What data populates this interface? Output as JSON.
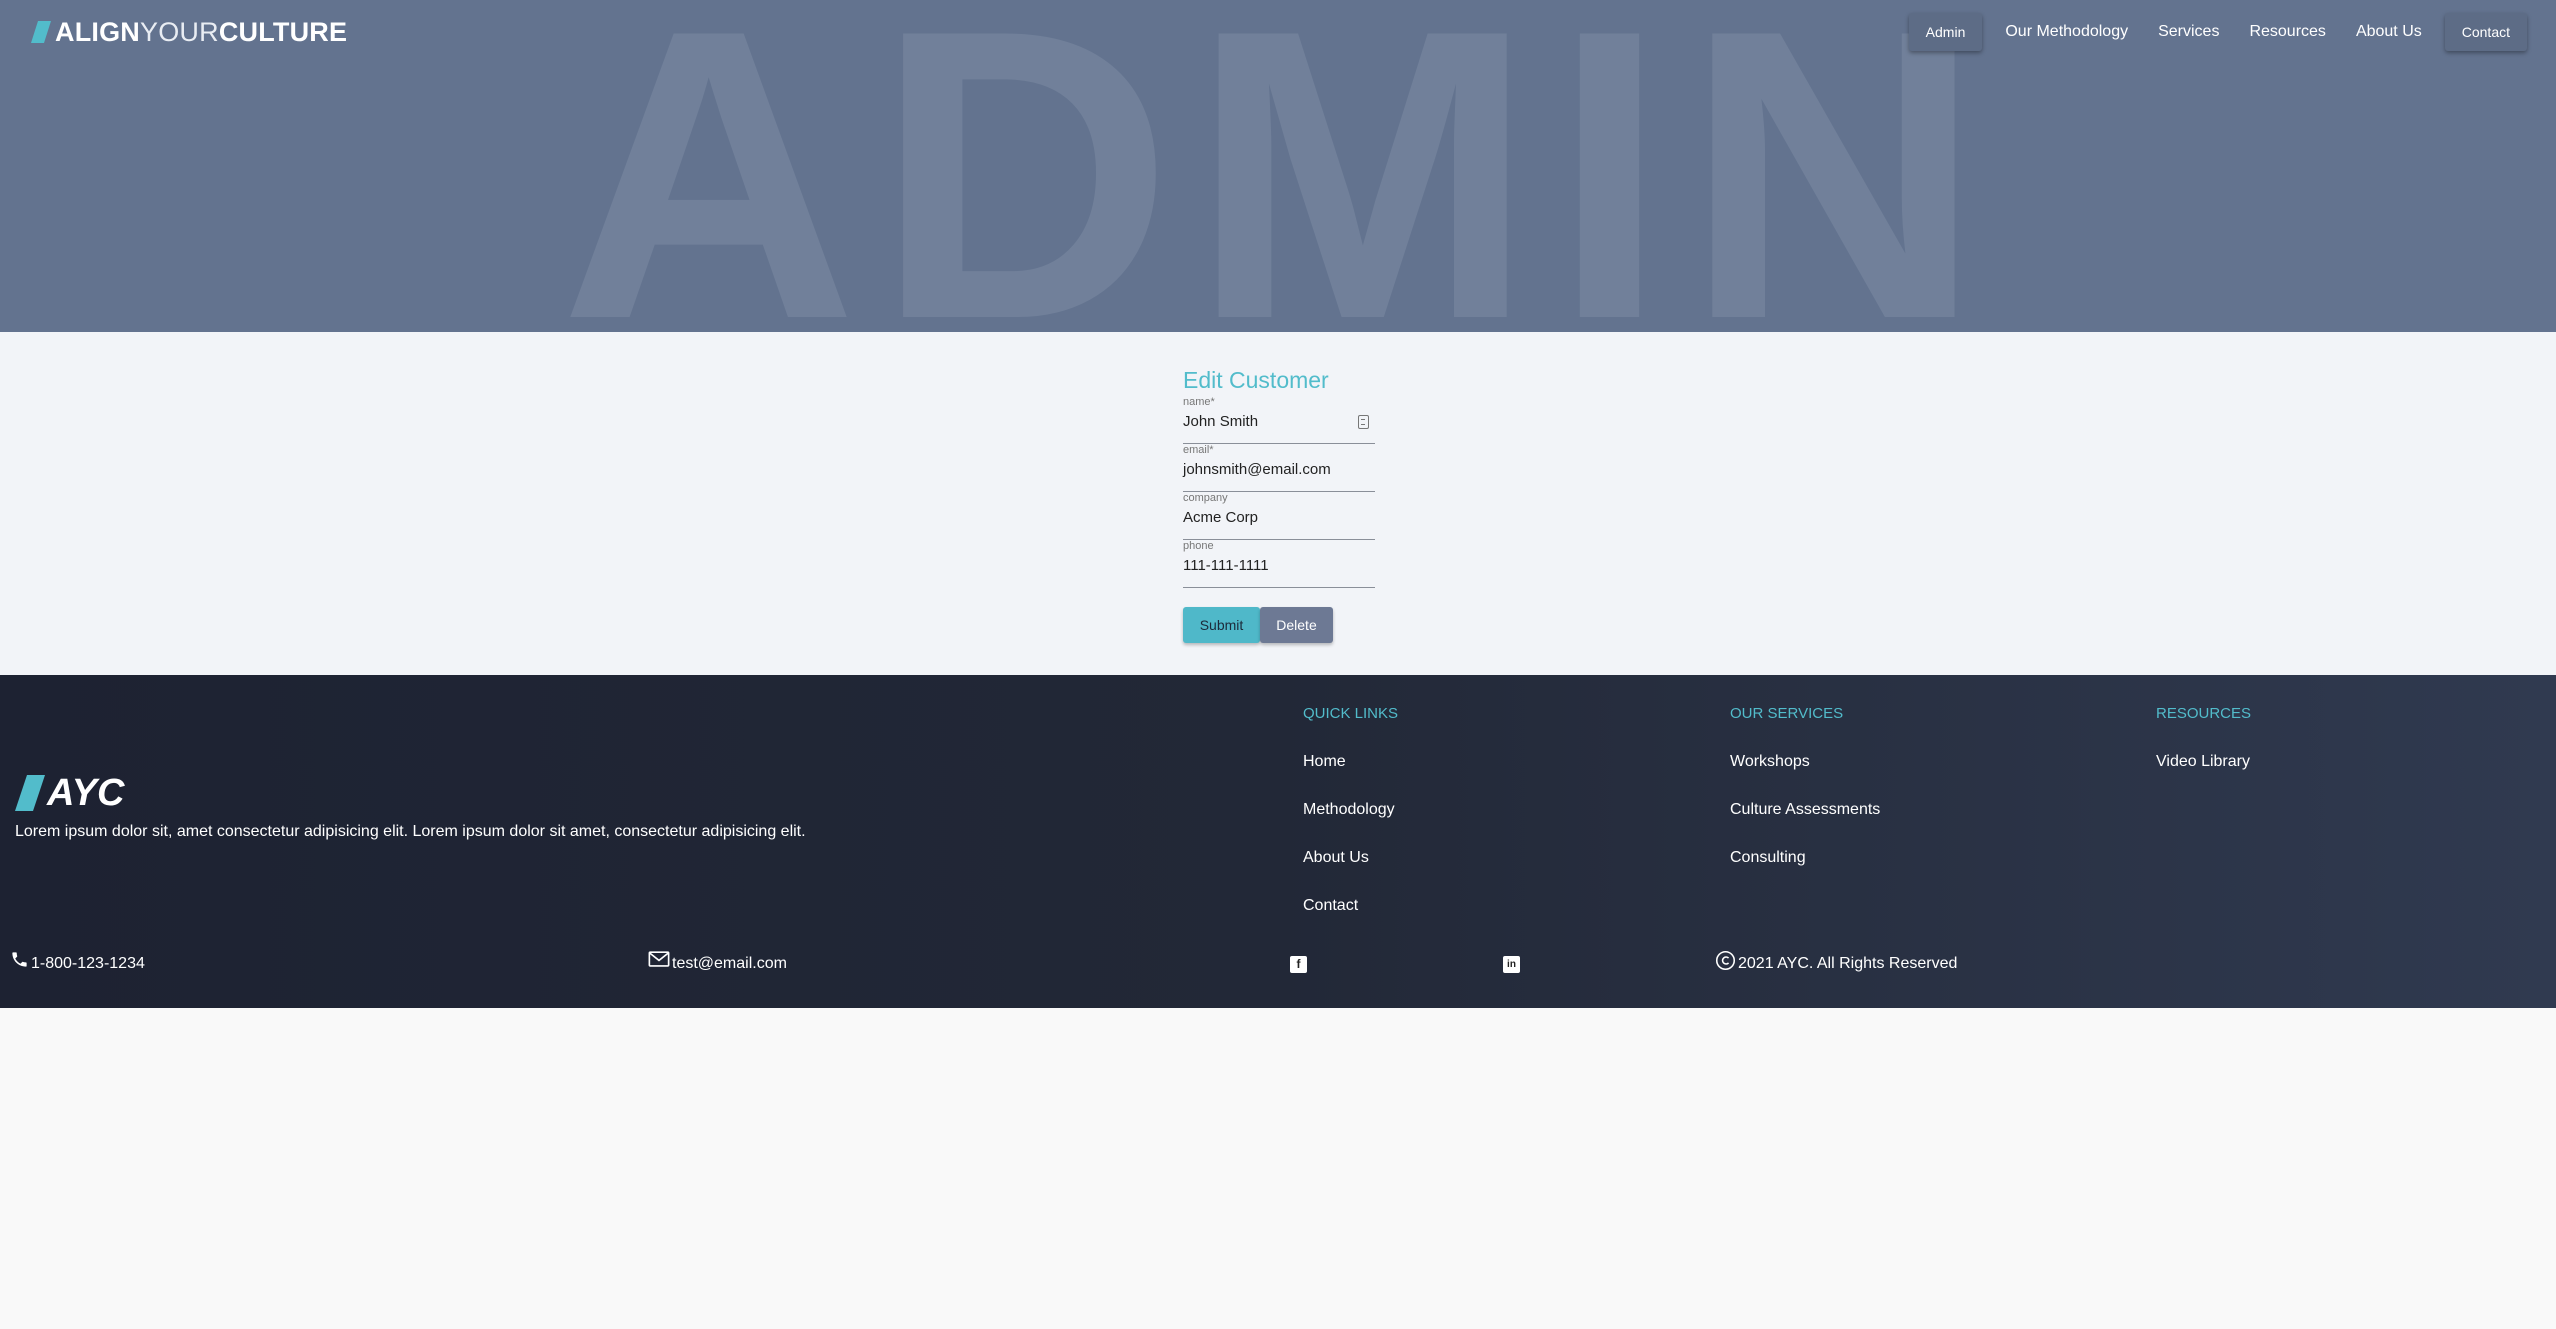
{
  "header": {
    "logo": {
      "part1": "ALIGN",
      "part2": "YOUR",
      "part3": "CULTURE"
    },
    "hero_bg_text": "ADMIN",
    "nav": [
      {
        "label": "Admin",
        "type": "button"
      },
      {
        "label": "Our Methodology",
        "type": "link"
      },
      {
        "label": "Services",
        "type": "link"
      },
      {
        "label": "Resources",
        "type": "link"
      },
      {
        "label": "About Us",
        "type": "link"
      },
      {
        "label": "Contact",
        "type": "button"
      }
    ]
  },
  "form": {
    "title": "Edit Customer",
    "fields": [
      {
        "label": "name*",
        "value": "John Smith",
        "icon": "contact-card-icon"
      },
      {
        "label": "email*",
        "value": "johnsmith@email.com"
      },
      {
        "label": "company",
        "value": "Acme Corp"
      },
      {
        "label": "phone",
        "value": "111-111-1111"
      }
    ],
    "submit_label": "Submit",
    "delete_label": "Delete"
  },
  "footer": {
    "logo_text": "AYC",
    "tagline": "Lorem ipsum dolor sit, amet consectetur adipisicing elit. Lorem ipsum dolor sit amet, consectetur adipisicing elit.",
    "quick_links": {
      "heading": "QUICK LINKS",
      "items": [
        "Home",
        "Methodology",
        "About Us",
        "Contact"
      ]
    },
    "services": {
      "heading": "OUR SERVICES",
      "items": [
        "Workshops",
        "Culture Assessments",
        "Consulting"
      ]
    },
    "resources": {
      "heading": "RESOURCES",
      "items": [
        "Video Library"
      ]
    },
    "phone": "1-800-123-1234",
    "email": "test@email.com",
    "social": [
      {
        "icon": "facebook-icon",
        "glyph": "f"
      },
      {
        "icon": "linkedin-icon",
        "glyph": "in"
      }
    ],
    "copyright": "2021 AYC. All Rights Reserved"
  },
  "colors": {
    "hero_bg": "#63738f",
    "accent": "#52bccb",
    "footer_bg": "#1d2232",
    "delete_button": "#6d7994"
  }
}
